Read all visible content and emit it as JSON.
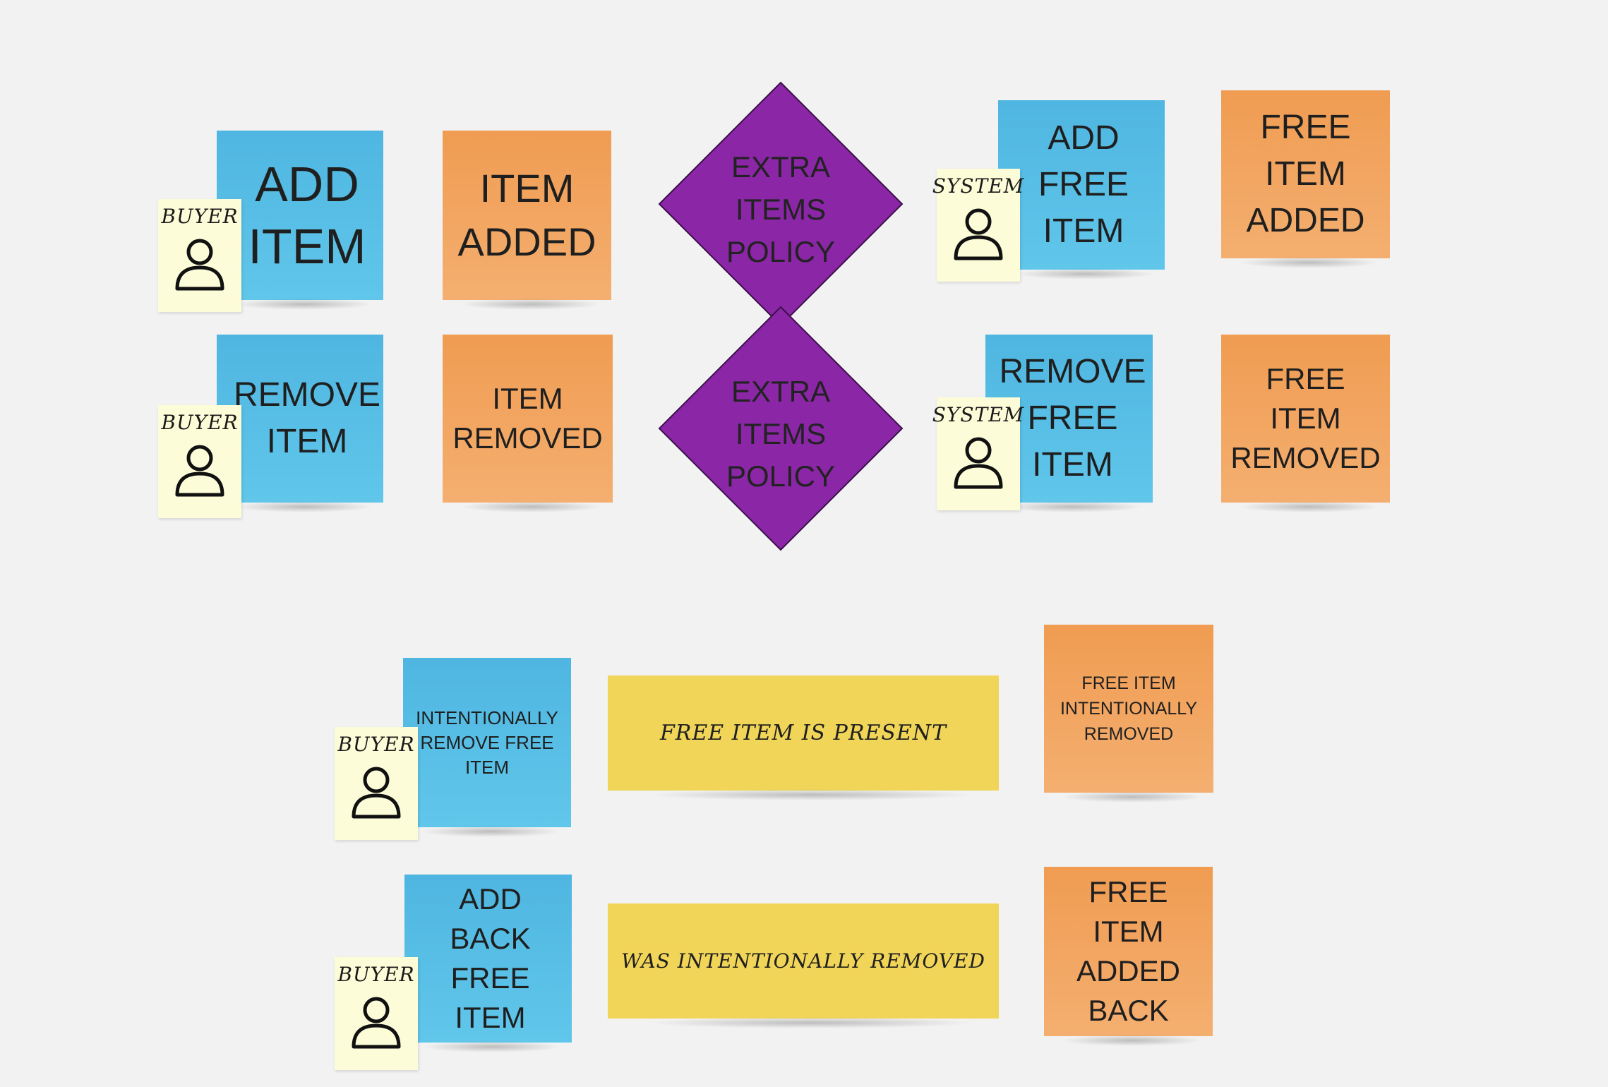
{
  "board": {
    "row1": {
      "command": "ADD\nITEM",
      "actor": "BUYER",
      "event": "ITEM\nADDED",
      "policy": "EXTRA\nITEMS\nPOLICY",
      "command2": "ADD\nFREE\nITEM",
      "actor2": "SYSTEM",
      "event2": "FREE\nITEM\nADDED"
    },
    "row2": {
      "command": "REMOVE\nITEM",
      "actor": "BUYER",
      "event": "ITEM\nREMOVED",
      "policy": "EXTRA\nITEMS\nPOLICY",
      "command2": "REMOVE\nFREE\nITEM",
      "actor2": "SYSTEM",
      "event2": "FREE ITEM\nREMOVED"
    },
    "row3": {
      "command": "INTENTIONALLY\nREMOVE FREE\nITEM",
      "actor": "BUYER",
      "condition": "FREE ITEM IS PRESENT",
      "event": "FREE ITEM\nINTENTIONALLY\nREMOVED"
    },
    "row4": {
      "command": "ADD BACK\nFREE ITEM",
      "actor": "BUYER",
      "condition": "WAS INTENTIONALLY REMOVED",
      "event": "FREE ITEM\nADDED\nBACK"
    }
  },
  "colors": {
    "command": "#55bce4",
    "event": "#f2a45e",
    "policy": "#8b27a6",
    "actor": "#fdfcd8",
    "condition": "#f0d558"
  },
  "icons": {
    "actor": "person-icon"
  }
}
